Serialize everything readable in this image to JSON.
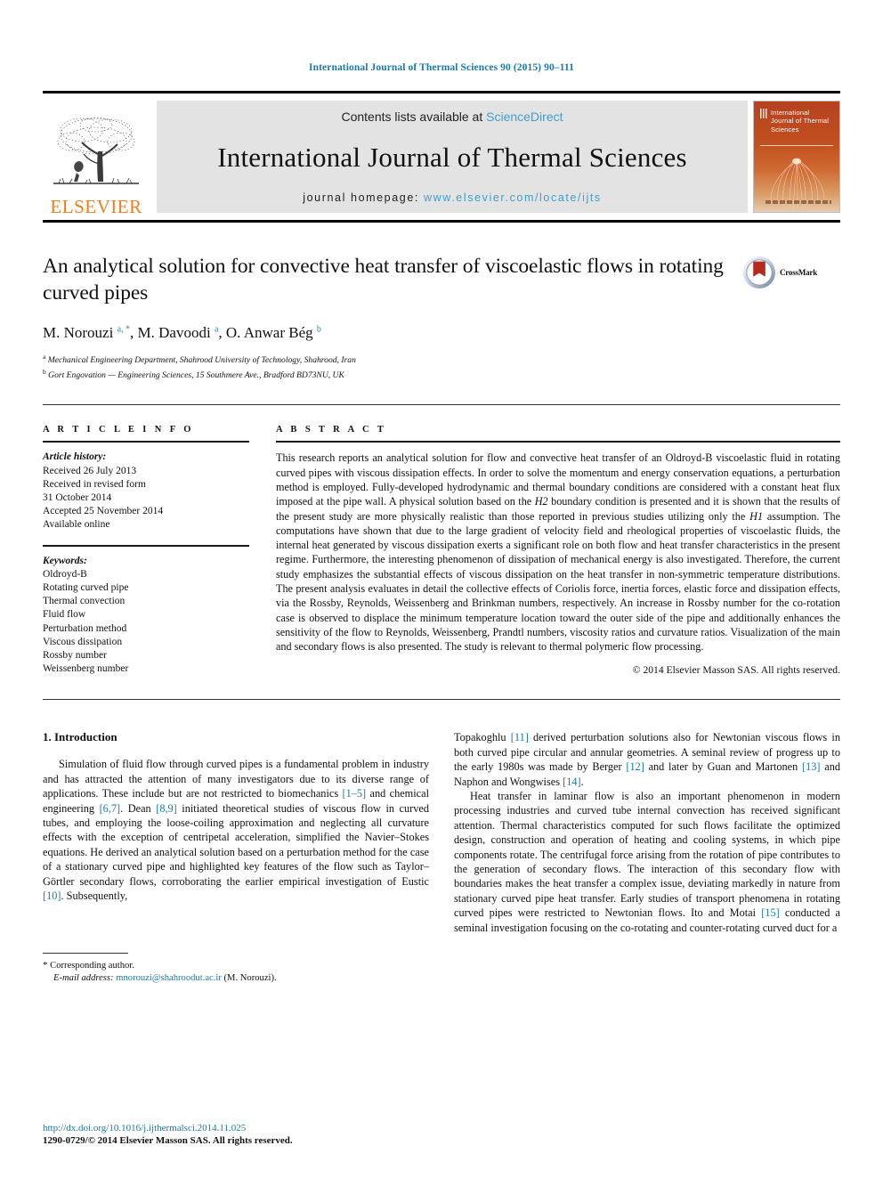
{
  "running_head": "International Journal of Thermal Sciences 90 (2015) 90–111",
  "masthead": {
    "publisher_wordmark": "ELSEVIER",
    "contents_prefix": "Contents lists available at ",
    "contents_link": "ScienceDirect",
    "journal_name": "International Journal of Thermal Sciences",
    "homepage_prefix": "journal homepage: ",
    "homepage_url": "www.elsevier.com/locate/ijts",
    "cover_title": "International Journal of Thermal Sciences",
    "link_color": "#3f9fcf",
    "brand_color": "#f07d1a"
  },
  "article": {
    "title": "An analytical solution for convective heat transfer of viscoelastic flows in rotating curved pipes",
    "authors_html": "M. Norouzi <sup>a, *</sup>, M. Davoodi <sup>a</sup>, O. Anwar Bég <sup>b</sup>",
    "affiliation_a": "Mechanical Engineering Department, Shahrood University of Technology, Shahrood, Iran",
    "affiliation_b": "Gort Engovation — Engineering Sciences, 15 Southmere Ave., Bradford BD73NU, UK",
    "crossmark_label": "CrossMark"
  },
  "article_info": {
    "heading": "A R T I C L E   I N F O",
    "history_label": "Article history:",
    "history": [
      "Received 26 July 2013",
      "Received in revised form",
      "31 October 2014",
      "Accepted 25 November 2014",
      "Available online"
    ],
    "keywords_label": "Keywords:",
    "keywords": [
      "Oldroyd-B",
      "Rotating curved pipe",
      "Thermal convection",
      "Fluid flow",
      "Perturbation method",
      "Viscous dissipation",
      "Rossby number",
      "Weissenberg number"
    ]
  },
  "abstract": {
    "heading": "A B S T R A C T",
    "text_part1": "This research reports an analytical solution for flow and convective heat transfer of an Oldroyd-B viscoelastic fluid in rotating curved pipes with viscous dissipation effects. In order to solve the momentum and energy conservation equations, a perturbation method is employed. Fully-developed hydrodynamic and thermal boundary conditions are considered with a constant heat flux imposed at the pipe wall. A physical solution based on the ",
    "italic1": "H2",
    "text_part2": " boundary condition is presented and it is shown that the results of the present study are more physically realistic than those reported in previous studies utilizing only the ",
    "italic2": "H1",
    "text_part3": " assumption. The computations have shown that due to the large gradient of velocity field and rheological properties of viscoelastic fluids, the internal heat generated by viscous dissipation exerts a significant role on both flow and heat transfer characteristics in the present regime. Furthermore, the interesting phenomenon of dissipation of mechanical energy is also investigated. Therefore, the current study emphasizes the substantial effects of viscous dissipation on the heat transfer in non-symmetric temperature distributions. The present analysis evaluates in detail the collective effects of Coriolis force, inertia forces, elastic force and dissipation effects, via the Rossby, Reynolds, Weissenberg and Brinkman numbers, respectively. An increase in Rossby number for the co-rotation case is observed to displace the minimum temperature location toward the outer side of the pipe and additionally enhances the sensitivity of the flow to Reynolds, Weissenberg, Prandtl numbers, viscosity ratios and curvature ratios. Visualization of the main and secondary flows is also presented. The study is relevant to thermal polymeric flow processing.",
    "copyright": "© 2014 Elsevier Masson SAS. All rights reserved."
  },
  "introduction": {
    "section_number_title": "1. Introduction",
    "left_p1_a": "Simulation of fluid flow through curved pipes is a fundamental problem in industry and has attracted the attention of many investigators due to its diverse range of applications. These include but are not restricted to biomechanics ",
    "left_ref1": "[1–5]",
    "left_p1_b": " and chemical engineering ",
    "left_ref2": "[6,7]",
    "left_p1_c": ". Dean ",
    "left_ref3": "[8,9]",
    "left_p1_d": " initiated theoretical studies of viscous flow in curved tubes, and employing the loose-coiling approximation and neglecting all curvature effects with the exception of centripetal acceleration, simplified the Navier–Stokes equations. He derived an analytical solution based on a perturbation method for the case of a stationary curved pipe and highlighted key features of the flow such as Taylor–Görtler secondary flows, corroborating the earlier empirical investigation of Eustic ",
    "left_ref4": "[10]",
    "left_p1_e": ". Subsequently,",
    "right_p1_a": "Topakoghlu ",
    "right_ref1": "[11]",
    "right_p1_b": " derived perturbation solutions also for Newtonian viscous flows in both curved pipe circular and annular geometries. A seminal review of progress up to the early 1980s was made by Berger ",
    "right_ref2": "[12]",
    "right_p1_c": " and later by Guan and Martonen ",
    "right_ref3": "[13]",
    "right_p1_d": " and Naphon and Wongwises ",
    "right_ref4": "[14]",
    "right_p1_e": ".",
    "right_p2_a": "Heat transfer in laminar flow is also an important phenomenon in modern processing industries and curved tube internal convection has received significant attention. Thermal characteristics computed for such flows facilitate the optimized design, construction and operation of heating and cooling systems, in which pipe components rotate. The centrifugal force arising from the rotation of pipe contributes to the generation of secondary flows. The interaction of this secondary flow with boundaries makes the heat transfer a complex issue, deviating markedly in nature from stationary curved pipe heat transfer. Early studies of transport phenomena in rotating curved pipes were restricted to Newtonian flows. Ito and Motai ",
    "right_ref5": "[15]",
    "right_p2_b": " conducted a seminal investigation focusing on the co-rotating and counter-rotating curved duct for a"
  },
  "footnote": {
    "star": "*",
    "corresponding": "Corresponding author.",
    "email_label": "E-mail address:",
    "email": "mnorouzi@shahroodut.ac.ir",
    "email_suffix": "(M. Norouzi)."
  },
  "doi_block": {
    "doi_url": "http://dx.doi.org/10.1016/j.ijthermalsci.2014.11.025",
    "issn_line": "1290-0729/© 2014 Elsevier Masson SAS. All rights reserved."
  }
}
